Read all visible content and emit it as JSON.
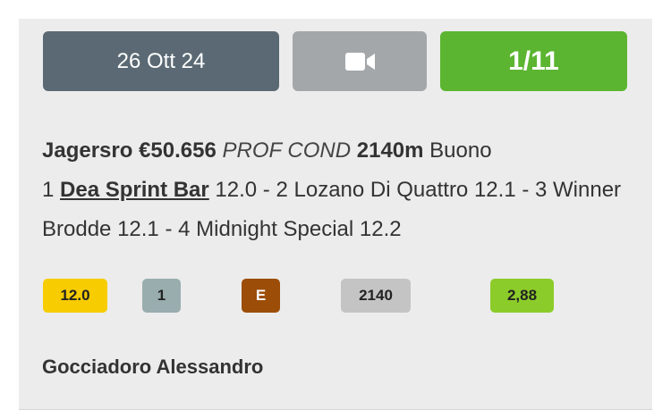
{
  "header": {
    "date_label": "26 Ott 24",
    "video_icon": "video-camera-icon",
    "odds_label": "1/11"
  },
  "race": {
    "track": "Jagersro",
    "prize": "€50.656",
    "type": "PROF COND",
    "distance": "2140m",
    "condition": "Buono",
    "results": [
      {
        "pos": "1",
        "name": "Dea Sprint Bar",
        "time": "12.0"
      },
      {
        "pos": "2",
        "name": "Lozano Di Quattro",
        "time": "12.1"
      },
      {
        "pos": "3",
        "name": "Winner Brodde",
        "time": "12.1"
      },
      {
        "pos": "4",
        "name": "Midnight Special",
        "time": "12.2"
      }
    ]
  },
  "badges": {
    "time": "12.0",
    "number": "1",
    "letter": "E",
    "distance": "2140",
    "quote": "2,88"
  },
  "jockey": "Gocciadoro Alessandro",
  "colors": {
    "date_button": "#5a6973",
    "video_button": "#a3a7aa",
    "odds_button": "#5cb531",
    "badge_time": "#f7cc00",
    "badge_number": "#99adaf",
    "badge_letter": "#9c4d07",
    "badge_distance": "#c4c4c4",
    "badge_quote": "#8ccc2a"
  }
}
